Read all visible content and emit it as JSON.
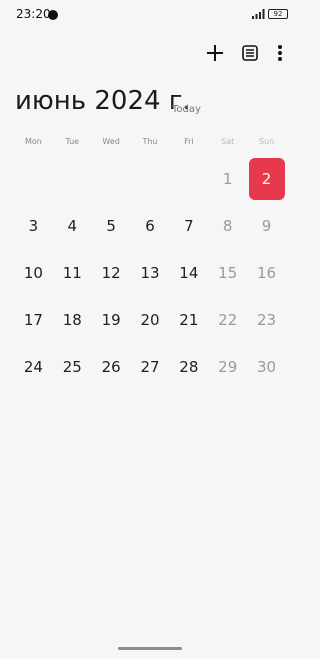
{
  "status": {
    "time": "23:20",
    "battery": "92"
  },
  "header": {
    "title": "июнь 2024 г.",
    "today_label": "Today"
  },
  "weekdays": [
    {
      "label": "Mon",
      "weekend": false
    },
    {
      "label": "Tue",
      "weekend": false
    },
    {
      "label": "Wed",
      "weekend": false
    },
    {
      "label": "Thu",
      "weekend": false
    },
    {
      "label": "Fri",
      "weekend": false
    },
    {
      "label": "Sat",
      "weekend": true
    },
    {
      "label": "Sun",
      "weekend": true
    }
  ],
  "days": [
    "",
    "",
    "",
    "",
    "",
    "1",
    "2",
    "3",
    "4",
    "5",
    "6",
    "7",
    "8",
    "9",
    "10",
    "11",
    "12",
    "13",
    "14",
    "15",
    "16",
    "17",
    "18",
    "19",
    "20",
    "21",
    "22",
    "23",
    "24",
    "25",
    "26",
    "27",
    "28",
    "29",
    "30"
  ],
  "selected_day": "2",
  "colors": {
    "accent": "#e6394b",
    "background": "#f6f6f6"
  },
  "icons": {
    "add": "plus-icon",
    "list": "list-view-icon",
    "more": "more-vertical-icon"
  }
}
